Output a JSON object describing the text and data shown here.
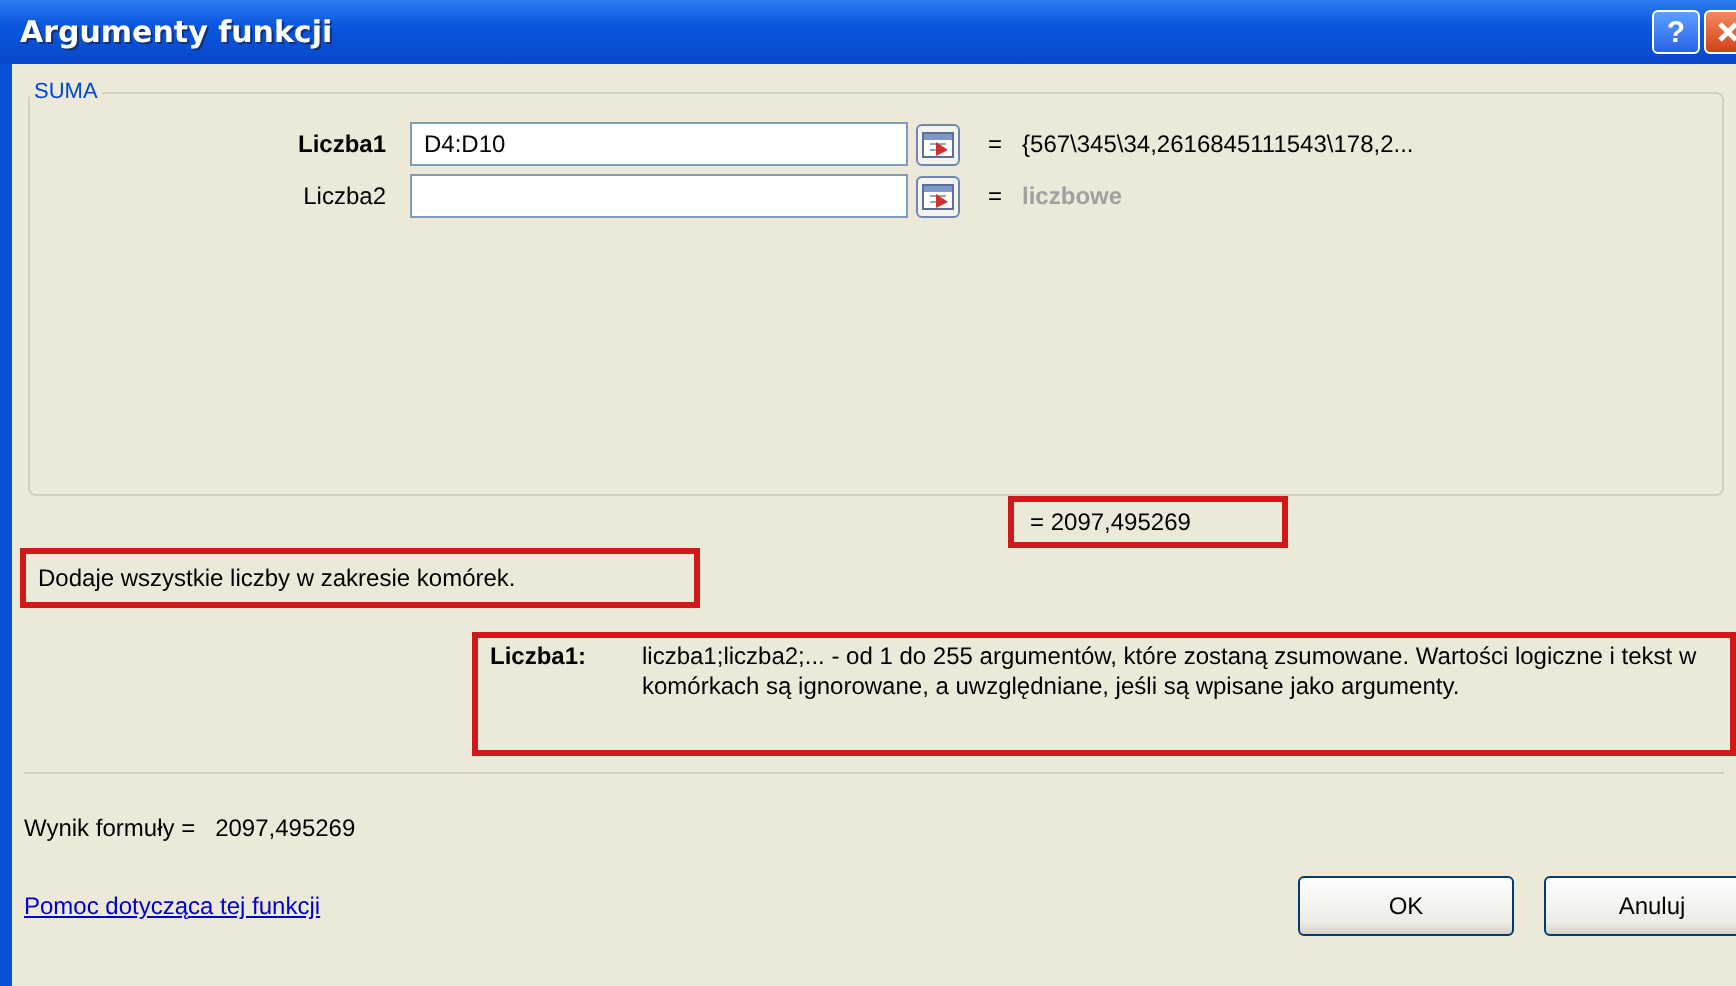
{
  "window": {
    "title": "Argumenty funkcji",
    "help_button": "?"
  },
  "function_group": {
    "name": "SUMA",
    "arguments": [
      {
        "label": "Liczba1",
        "bold": true,
        "value": "D4:D10",
        "equals": "=",
        "result": "{567\\345\\34,2616845111543\\178,2...",
        "result_muted": false
      },
      {
        "label": "Liczba2",
        "bold": false,
        "equals": "=",
        "result": "liczbowe",
        "result_muted": true
      }
    ]
  },
  "result": {
    "text": "=  2097,495269",
    "highlighted": true
  },
  "description": {
    "text": "Dodaje wszystkie liczby w zakresie komórek.",
    "highlighted": true
  },
  "argument_help": {
    "label": "Liczba1:",
    "text": "liczba1;liczba2;... - od 1 do 255 argumentów, które zostaną zsumowane. Wartości logiczne i tekst w komórkach są ignorowane, a uwzględniane, jeśli są wpisane jako argumenty.",
    "highlighted": true
  },
  "formula_result": {
    "label": "Wynik formuły =",
    "value": "2097,495269"
  },
  "help_link": "Pomoc dotycząca tej funkcji",
  "buttons": [
    "OK",
    "Anuluj"
  ]
}
